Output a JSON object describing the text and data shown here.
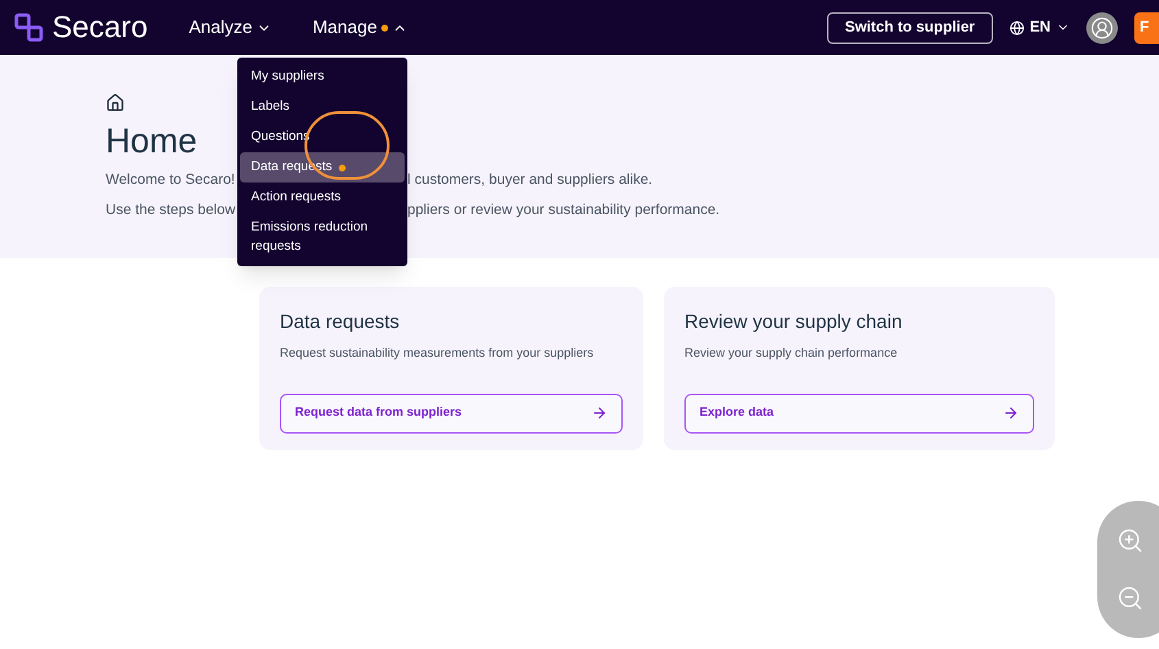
{
  "header": {
    "logo": "Secaro",
    "nav": [
      {
        "label": "Analyze",
        "expanded": false,
        "dot": false
      },
      {
        "label": "Manage",
        "expanded": true,
        "dot": true
      }
    ],
    "switch_button": "Switch to supplier",
    "language": "EN",
    "cta": "F"
  },
  "menu": {
    "items": [
      {
        "label": "My suppliers",
        "selected": false,
        "dot": false
      },
      {
        "label": "Labels",
        "selected": false,
        "dot": false
      },
      {
        "label": "Questions",
        "selected": false,
        "dot": false
      },
      {
        "label": "Data requests",
        "selected": true,
        "dot": true
      },
      {
        "label": "Action requests",
        "selected": false,
        "dot": false
      },
      {
        "label": "Emissions reduction requests",
        "selected": false,
        "dot": false
      }
    ]
  },
  "hero": {
    "title": "Home",
    "lines": [
      [
        "Welcome to Secaro!",
        "l customers, buyer and suppliers alike."
      ],
      [
        "Use the steps below",
        "ppliers or review your sustainability performance."
      ]
    ]
  },
  "cards": [
    {
      "title": "Data requests",
      "description": "Request sustainability measurements from your suppliers",
      "action": "Request data from suppliers"
    },
    {
      "title": "Review your supply chain",
      "description": "Review your supply chain performance",
      "action": "Explore data"
    }
  ]
}
